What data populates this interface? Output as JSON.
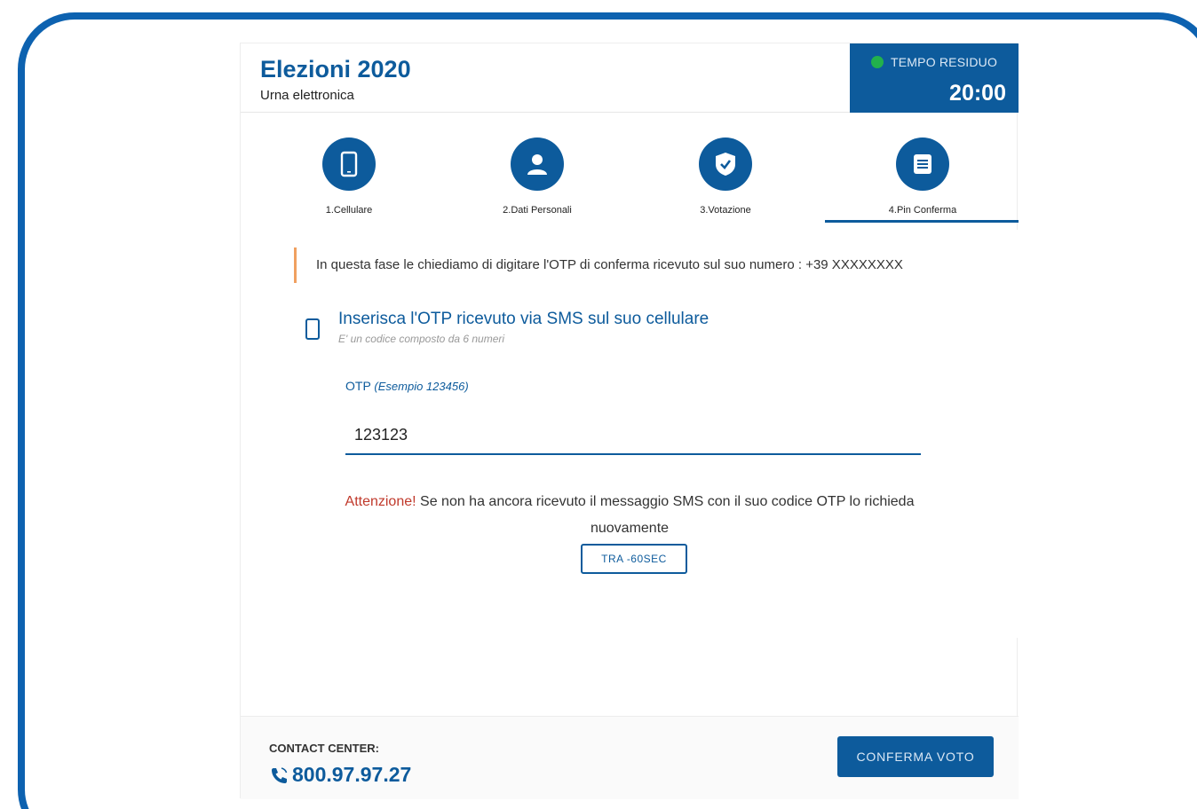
{
  "app": {
    "title": "Elezioni 2020",
    "subtitle": "Urna elettronica"
  },
  "timer": {
    "label": "TEMPO RESIDUO",
    "value": "20:00",
    "status_color": "#22b14c"
  },
  "steps": [
    {
      "label": "1.Cellulare",
      "icon": "phone-icon"
    },
    {
      "label": "2.Dati Personali",
      "icon": "user-icon"
    },
    {
      "label": "3.Votazione",
      "icon": "shield-check-icon"
    },
    {
      "label": "4.Pin Conferma",
      "icon": "list-icon",
      "active": true
    }
  ],
  "notice": {
    "text": "In questa fase le chiediamo di digitare l'OTP di conferma ricevuto sul suo numero : +39 XXXXXXXX"
  },
  "otp": {
    "heading": "Inserisca l'OTP ricevuto via SMS sul suo cellulare",
    "subheading": "E' un codice composto da 6 numeri",
    "label": "OTP",
    "label_hint": "(Esempio 123456)",
    "value": "123123"
  },
  "warning": {
    "prefix": "Attenzione!",
    "text": " Se non ha ancora ricevuto il messaggio SMS con il suo codice OTP lo richieda nuovamente"
  },
  "resend_button": {
    "label": "TRA -60SEC"
  },
  "footer": {
    "contact_label": "CONTACT CENTER:",
    "contact_phone": "800.97.97.27",
    "confirm_label": "CONFERMA VOTO"
  },
  "colors": {
    "primary": "#0d5b9c",
    "warning": "#c0392b",
    "notice_border": "#f0a060"
  }
}
